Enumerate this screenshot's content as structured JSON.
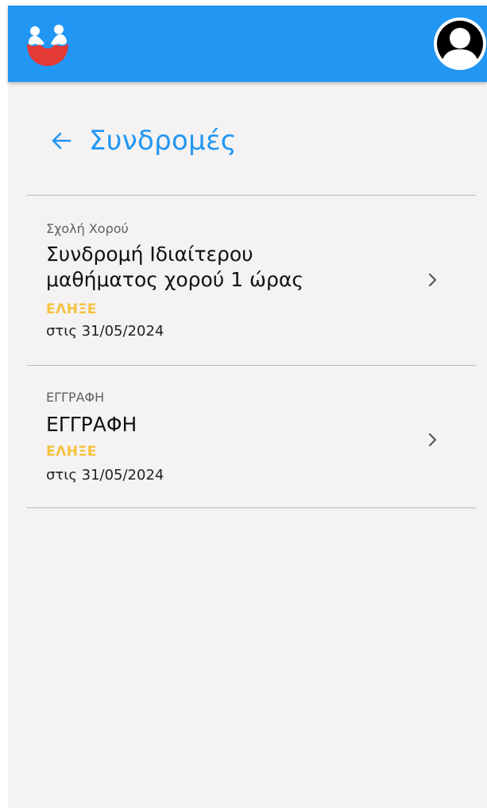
{
  "app": {
    "accent_color": "#2196f3",
    "status_color": "#f6c23c",
    "logo_icon": "logo-two-people-icon",
    "profile_icon": "account-avatar-icon"
  },
  "header": {
    "back_icon": "arrow-left-icon",
    "title": "Συνδρομές"
  },
  "subscriptions": [
    {
      "category": "Σχολή Χορού",
      "title_lines": [
        "Συνδρομή Ιδιαίτερου",
        "μαθήματος χορού 1 ώρας"
      ],
      "status": "ΕΛΗΞΕ",
      "date": "στις 31/05/2024",
      "chevron_icon": "chevron-right-icon"
    },
    {
      "category": "ΕΓΓΡΑΦΗ",
      "title_lines": [
        "ΕΓΓΡΑΦΗ"
      ],
      "status": "ΕΛΗΞΕ",
      "date": "στις 31/05/2024",
      "chevron_icon": "chevron-right-icon"
    }
  ]
}
